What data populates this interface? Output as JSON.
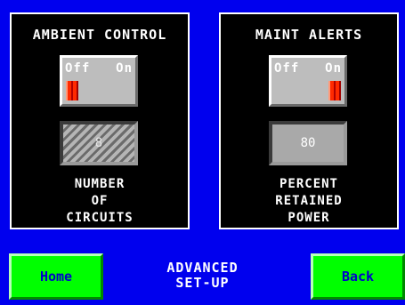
{
  "panels": [
    {
      "title": "AMBIENT CONTROL",
      "toggle": {
        "off_label": "Off",
        "on_label": "On",
        "state": "off"
      },
      "value": "8",
      "value_state": "disabled",
      "caption": [
        "NUMBER",
        "OF",
        "CIRCUITS"
      ]
    },
    {
      "title": "MAINT ALERTS",
      "toggle": {
        "off_label": "Off",
        "on_label": "On",
        "state": "on"
      },
      "value": "80",
      "value_state": "enabled",
      "caption": [
        "PERCENT",
        "RETAINED",
        "POWER"
      ]
    }
  ],
  "footer": {
    "home_label": "Home",
    "back_label": "Back",
    "title_line1": "ADVANCED",
    "title_line2": "SET-UP"
  },
  "colors": {
    "background": "#0000ee",
    "panel": "#000000",
    "nav_button": "#00ff00",
    "indicator": "#ff2a00"
  }
}
